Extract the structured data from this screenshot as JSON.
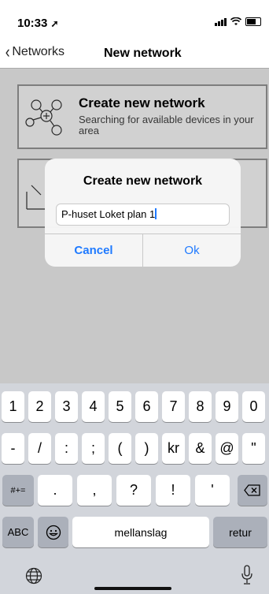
{
  "status": {
    "time": "10:33"
  },
  "nav": {
    "back_label": "Networks",
    "title": "New network"
  },
  "card": {
    "title": "Create new network",
    "description": "Searching for available devices in your area"
  },
  "alert": {
    "title": "Create new network",
    "input_value": "P-huset Loket plan 1",
    "cancel": "Cancel",
    "ok": "Ok"
  },
  "keyboard": {
    "row1": [
      "1",
      "2",
      "3",
      "4",
      "5",
      "6",
      "7",
      "8",
      "9",
      "0"
    ],
    "row2": [
      "-",
      "/",
      ":",
      ";",
      "(",
      ")",
      "kr",
      "&",
      "@",
      "\""
    ],
    "row3_mode": "#+=",
    "row3": [
      ".",
      ",",
      "?",
      "!",
      "'"
    ],
    "abc": "ABC",
    "space": "mellanslag",
    "return": "retur"
  },
  "colors": {
    "accent": "#1f7aff",
    "keyboard_bg": "#d2d5db"
  }
}
